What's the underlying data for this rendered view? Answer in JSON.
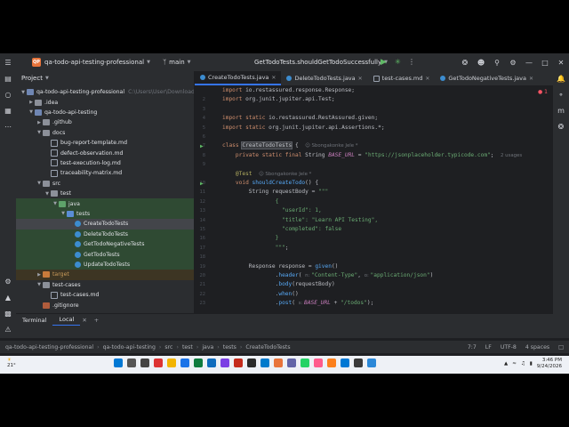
{
  "titlebar": {
    "project_badge": "QP",
    "project_name": "qa-todo-api-testing-professional",
    "branch": "main",
    "run_config": "GetTodoTests.shouldGetTodoSuccessfully"
  },
  "project_panel": {
    "title": "Project",
    "tree": [
      {
        "label": "qa-todo-api-testing-professional",
        "suffix": "C:\\Users\\User\\Download",
        "depth": 0,
        "icon": "module",
        "open": true
      },
      {
        "label": ".idea",
        "depth": 1,
        "icon": "folder",
        "open": false
      },
      {
        "label": "qa-todo-api-testing",
        "depth": 1,
        "icon": "module",
        "open": true
      },
      {
        "label": ".github",
        "depth": 2,
        "icon": "folder",
        "open": false
      },
      {
        "label": "docs",
        "depth": 2,
        "icon": "folder",
        "open": true
      },
      {
        "label": "bug-report-template.md",
        "depth": 3,
        "icon": "md"
      },
      {
        "label": "defect-observation.md",
        "depth": 3,
        "icon": "md"
      },
      {
        "label": "test-execution-log.md",
        "depth": 3,
        "icon": "md"
      },
      {
        "label": "traceability-matrix.md",
        "depth": 3,
        "icon": "md"
      },
      {
        "label": "src",
        "depth": 2,
        "icon": "folder",
        "open": true
      },
      {
        "label": "test",
        "depth": 3,
        "icon": "folder",
        "open": true
      },
      {
        "label": "java",
        "depth": 4,
        "icon": "folder-green",
        "open": true,
        "row": "green"
      },
      {
        "label": "tests",
        "depth": 5,
        "icon": "folder-blue",
        "open": true,
        "row": "green"
      },
      {
        "label": "CreateTodoTests",
        "depth": 6,
        "icon": "java",
        "row": "selected"
      },
      {
        "label": "DeleteTodoTests",
        "depth": 6,
        "icon": "java",
        "row": "green"
      },
      {
        "label": "GetTodoNegativeTests",
        "depth": 6,
        "icon": "java",
        "row": "green"
      },
      {
        "label": "GetTodoTests",
        "depth": 6,
        "icon": "java",
        "row": "green"
      },
      {
        "label": "UpdateTodoTests",
        "depth": 6,
        "icon": "java",
        "row": "green"
      },
      {
        "label": "target",
        "depth": 2,
        "icon": "folder-orange",
        "open": false,
        "row": "orange"
      },
      {
        "label": "test-cases",
        "depth": 2,
        "icon": "folder",
        "open": true
      },
      {
        "label": "test-cases.md",
        "depth": 3,
        "icon": "md"
      },
      {
        "label": ".gitignore",
        "depth": 2,
        "icon": "git"
      }
    ]
  },
  "editor": {
    "tabs": [
      {
        "label": "CreateTodoTests.java",
        "icon": "java",
        "active": true
      },
      {
        "label": "DeleteTodoTests.java",
        "icon": "java",
        "active": false
      },
      {
        "label": "test-cases.md",
        "icon": "md",
        "active": false
      },
      {
        "label": "GetTodoNegativeTests.java",
        "icon": "java",
        "active": false
      }
    ],
    "error_count": "1",
    "lines": [
      {
        "n": "",
        "tokens": [
          [
            "kw",
            "import "
          ],
          [
            "p",
            "io.restassured.response.Response;"
          ]
        ]
      },
      {
        "n": "2",
        "tokens": [
          [
            "kw",
            "import "
          ],
          [
            "p",
            "org.junit.jupiter.api.Test;"
          ]
        ]
      },
      {
        "n": "3",
        "tokens": []
      },
      {
        "n": "4",
        "tokens": [
          [
            "kw",
            "import static "
          ],
          [
            "p",
            "io.restassured.RestAssured.given;"
          ]
        ]
      },
      {
        "n": "5",
        "tokens": [
          [
            "kw",
            "import static "
          ],
          [
            "p",
            "org.junit.jupiter.api.Assertions.*;"
          ]
        ]
      },
      {
        "n": "6",
        "tokens": []
      },
      {
        "n": "7",
        "gutter": "run",
        "tokens": [
          [
            "kw",
            "class "
          ],
          [
            "hl",
            "CreateTodoTests"
          ],
          [
            "p",
            " {  "
          ],
          [
            "hint",
            "☺ Sbongakonke Jele *"
          ]
        ]
      },
      {
        "n": "8",
        "tokens": [
          [
            "p",
            "    "
          ],
          [
            "kw",
            "private static final "
          ],
          [
            "p",
            "String "
          ],
          [
            "cst",
            "BASE_URL"
          ],
          [
            "p",
            " = "
          ],
          [
            "str",
            "\"https://jsonplaceholder.typicode.com\""
          ],
          [
            "p",
            ";  "
          ],
          [
            "hint",
            "2 usages"
          ]
        ]
      },
      {
        "n": "9",
        "tokens": []
      },
      {
        "n": "",
        "tokens": [
          [
            "p",
            "    "
          ],
          [
            "an",
            "@Test  "
          ],
          [
            "hint",
            "☺ Sbongakonke Jele *"
          ]
        ]
      },
      {
        "n": "10",
        "gutter": "run",
        "tokens": [
          [
            "p",
            "    "
          ],
          [
            "kw",
            "void "
          ],
          [
            "fn",
            "shouldCreateTodo"
          ],
          [
            "p",
            "() {"
          ]
        ]
      },
      {
        "n": "11",
        "tokens": [
          [
            "p",
            "        String requestBody = "
          ],
          [
            "str",
            "\"\"\""
          ]
        ]
      },
      {
        "n": "12",
        "tokens": [
          [
            "str",
            "                {"
          ]
        ]
      },
      {
        "n": "13",
        "tokens": [
          [
            "str",
            "                  \"userId\": 1,"
          ]
        ]
      },
      {
        "n": "14",
        "tokens": [
          [
            "str",
            "                  \"title\": \"Learn API Testing\","
          ]
        ]
      },
      {
        "n": "15",
        "tokens": [
          [
            "str",
            "                  \"completed\": false"
          ]
        ]
      },
      {
        "n": "16",
        "tokens": [
          [
            "str",
            "                }"
          ]
        ]
      },
      {
        "n": "17",
        "tokens": [
          [
            "str",
            "                \"\"\""
          ],
          [
            "p",
            ";"
          ]
        ]
      },
      {
        "n": "18",
        "tokens": []
      },
      {
        "n": "19",
        "tokens": [
          [
            "p",
            "        Response response = "
          ],
          [
            "fn",
            "given"
          ],
          [
            "p",
            "()"
          ]
        ]
      },
      {
        "n": "20",
        "tokens": [
          [
            "p",
            "                ."
          ],
          [
            "fn",
            "header"
          ],
          [
            "p",
            "( "
          ],
          [
            "hint",
            "n: "
          ],
          [
            "str",
            "\"Content-Type\""
          ],
          [
            "p",
            ", "
          ],
          [
            "hint",
            "o: "
          ],
          [
            "str",
            "\"application/json\""
          ],
          [
            "p",
            ")"
          ]
        ]
      },
      {
        "n": "21",
        "tokens": [
          [
            "p",
            "                ."
          ],
          [
            "fn",
            "body"
          ],
          [
            "p",
            "(requestBody)"
          ]
        ]
      },
      {
        "n": "22",
        "tokens": [
          [
            "p",
            "                ."
          ],
          [
            "fn",
            "when"
          ],
          [
            "p",
            "()"
          ]
        ]
      },
      {
        "n": "23",
        "tokens": [
          [
            "p",
            "                ."
          ],
          [
            "fn",
            "post"
          ],
          [
            "p",
            "( "
          ],
          [
            "hint",
            "s: "
          ],
          [
            "cst",
            "BASE_URL"
          ],
          [
            "p",
            " + "
          ],
          [
            "str",
            "\"/todos\""
          ],
          [
            "p",
            ");"
          ]
        ]
      }
    ]
  },
  "terminal": {
    "title": "Terminal",
    "tab": "Local"
  },
  "statusbar": {
    "breadcrumbs": [
      "qa-todo-api-testing-professional",
      "qa-todo-api-testing",
      "src",
      "test",
      "java",
      "tests",
      "CreateTodoTests"
    ],
    "position": "7:7",
    "line_sep": "LF",
    "encoding": "UTF-8",
    "indent": "4 spaces"
  },
  "taskbar": {
    "temp": "21°",
    "clock_time": "3:46 PM",
    "clock_date": "9/24/2026"
  },
  "colors": {
    "accent": "#3574f0",
    "panel": "#2b2d30",
    "editor_bg": "#1e1f22"
  }
}
